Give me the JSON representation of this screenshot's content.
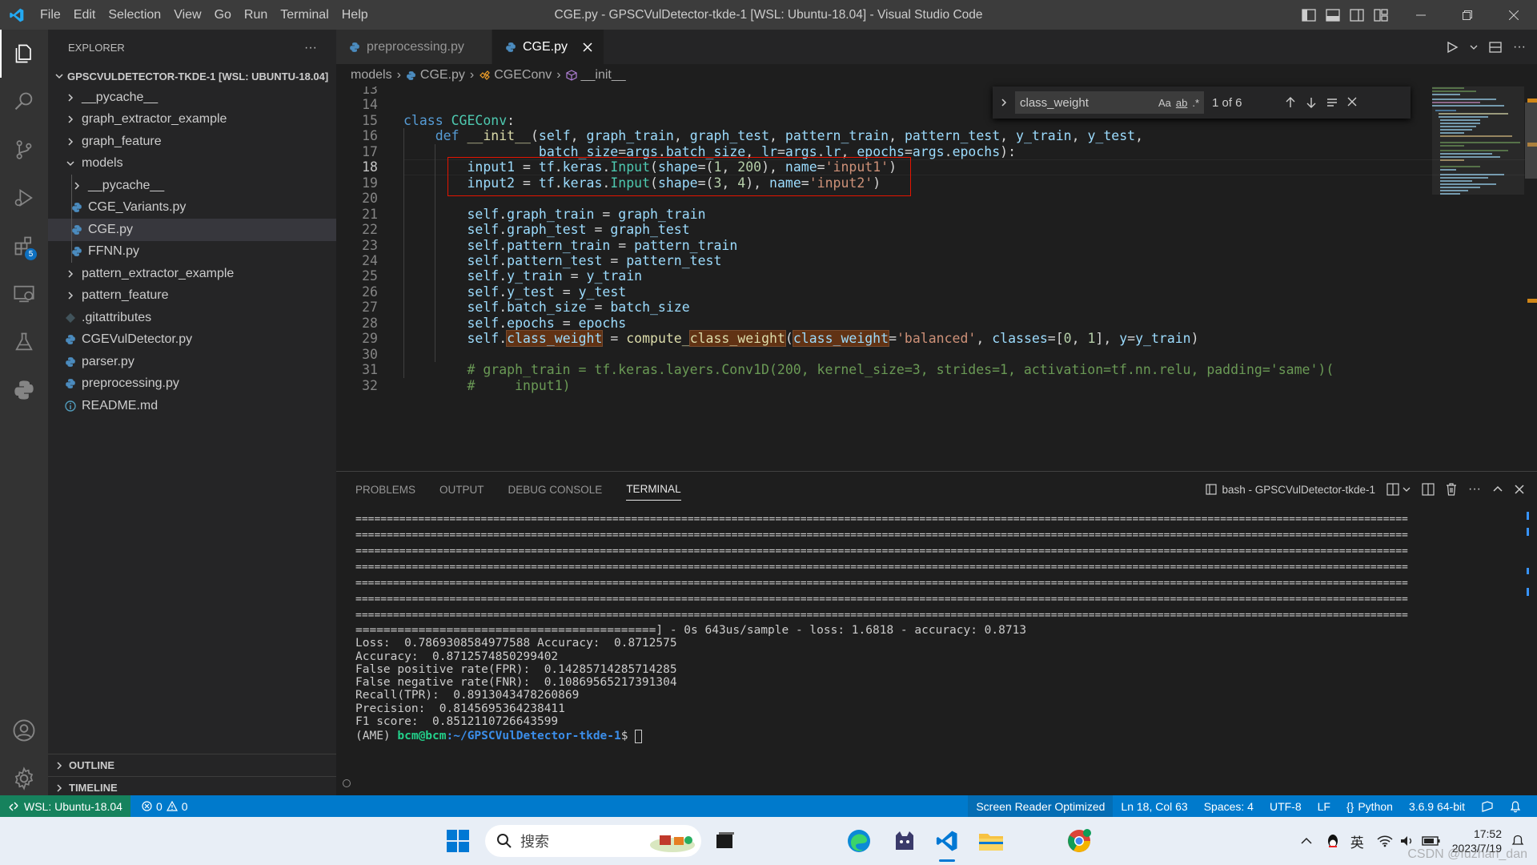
{
  "window": {
    "title": "CGE.py - GPSCVulDetector-tkde-1 [WSL: Ubuntu-18.04] - Visual Studio Code",
    "menu": [
      "File",
      "Edit",
      "Selection",
      "View",
      "Go",
      "Run",
      "Terminal",
      "Help"
    ]
  },
  "activity_bar": {
    "extensions_badge": "5",
    "icons": [
      "explorer-icon",
      "search-icon",
      "source-control-icon",
      "run-debug-icon",
      "extensions-icon",
      "remote-explorer-icon",
      "testing-icon",
      "python-icon",
      "accounts-icon",
      "settings-icon"
    ]
  },
  "explorer": {
    "header": "EXPLORER",
    "more": "···",
    "root": "GPSCVULDETECTOR-TKDE-1 [WSL: UBUNTU-18.04]",
    "items": [
      {
        "label": "__pycache__",
        "type": "folder",
        "depth": 0,
        "open": false
      },
      {
        "label": "graph_extractor_example",
        "type": "folder",
        "depth": 0,
        "open": false
      },
      {
        "label": "graph_feature",
        "type": "folder",
        "depth": 0,
        "open": false
      },
      {
        "label": "models",
        "type": "folder",
        "depth": 0,
        "open": true
      },
      {
        "label": "__pycache__",
        "type": "folder",
        "depth": 1,
        "open": false
      },
      {
        "label": "CGE_Variants.py",
        "type": "py",
        "depth": 1
      },
      {
        "label": "CGE.py",
        "type": "py",
        "depth": 1,
        "selected": true
      },
      {
        "label": "FFNN.py",
        "type": "py",
        "depth": 1
      },
      {
        "label": "pattern_extractor_example",
        "type": "folder",
        "depth": 0,
        "open": false
      },
      {
        "label": "pattern_feature",
        "type": "folder",
        "depth": 0,
        "open": false
      },
      {
        "label": ".gitattributes",
        "type": "git",
        "depth": 0
      },
      {
        "label": "CGEVulDetector.py",
        "type": "py",
        "depth": 0
      },
      {
        "label": "parser.py",
        "type": "py",
        "depth": 0
      },
      {
        "label": "preprocessing.py",
        "type": "py",
        "depth": 0
      },
      {
        "label": "README.md",
        "type": "md",
        "depth": 0
      }
    ],
    "outline": "OUTLINE",
    "timeline": "TIMELINE"
  },
  "tabs": [
    {
      "label": "preprocessing.py",
      "active": false
    },
    {
      "label": "CGE.py",
      "active": true
    }
  ],
  "breadcrumb": [
    "models",
    "CGE.py",
    "CGEConv",
    "__init__"
  ],
  "find_widget": {
    "query": "class_weight",
    "case_opt": "Aa",
    "word_opt": "ab",
    "regex_opt": ".*",
    "count": "1 of 6"
  },
  "editor": {
    "current_line": "18",
    "lines": [
      {
        "n": "13",
        "t": []
      },
      {
        "n": "14",
        "t": []
      },
      {
        "n": "15",
        "t": [
          [
            "kw",
            "class "
          ],
          [
            "cls",
            "CGEConv"
          ],
          [
            "pl",
            ":"
          ]
        ]
      },
      {
        "n": "16",
        "t": [
          [
            "pl",
            "    "
          ],
          [
            "kw",
            "def "
          ],
          [
            "fn",
            "__init__"
          ],
          [
            "pl",
            "("
          ],
          [
            "var",
            "self"
          ],
          [
            "pl",
            ", "
          ],
          [
            "var",
            "graph_train"
          ],
          [
            "pl",
            ", "
          ],
          [
            "var",
            "graph_test"
          ],
          [
            "pl",
            ", "
          ],
          [
            "var",
            "pattern_train"
          ],
          [
            "pl",
            ", "
          ],
          [
            "var",
            "pattern_test"
          ],
          [
            "pl",
            ", "
          ],
          [
            "var",
            "y_train"
          ],
          [
            "pl",
            ", "
          ],
          [
            "var",
            "y_test"
          ],
          [
            "pl",
            ","
          ]
        ]
      },
      {
        "n": "17",
        "t": [
          [
            "pl",
            "                 "
          ],
          [
            "var",
            "batch_size"
          ],
          [
            "pl",
            "="
          ],
          [
            "var",
            "args"
          ],
          [
            "pl",
            "."
          ],
          [
            "var",
            "batch_size"
          ],
          [
            "pl",
            ", "
          ],
          [
            "var",
            "lr"
          ],
          [
            "pl",
            "="
          ],
          [
            "var",
            "args"
          ],
          [
            "pl",
            "."
          ],
          [
            "var",
            "lr"
          ],
          [
            "pl",
            ", "
          ],
          [
            "var",
            "epochs"
          ],
          [
            "pl",
            "="
          ],
          [
            "var",
            "args"
          ],
          [
            "pl",
            "."
          ],
          [
            "var",
            "epochs"
          ],
          [
            "pl",
            "):"
          ]
        ]
      },
      {
        "n": "18",
        "t": [
          [
            "pl",
            "        "
          ],
          [
            "var",
            "input1"
          ],
          [
            "pl",
            " = "
          ],
          [
            "var",
            "tf"
          ],
          [
            "pl",
            "."
          ],
          [
            "var",
            "keras"
          ],
          [
            "pl",
            "."
          ],
          [
            "cls",
            "Input"
          ],
          [
            "pl",
            "("
          ],
          [
            "var",
            "shape"
          ],
          [
            "pl",
            "=("
          ],
          [
            "num",
            "1"
          ],
          [
            "pl",
            ", "
          ],
          [
            "num",
            "200"
          ],
          [
            "pl",
            "), "
          ],
          [
            "var",
            "name"
          ],
          [
            "pl",
            "="
          ],
          [
            "str",
            "'input1'"
          ],
          [
            "pl",
            ")"
          ]
        ]
      },
      {
        "n": "19",
        "t": [
          [
            "pl",
            "        "
          ],
          [
            "var",
            "input2"
          ],
          [
            "pl",
            " = "
          ],
          [
            "var",
            "tf"
          ],
          [
            "pl",
            "."
          ],
          [
            "var",
            "keras"
          ],
          [
            "pl",
            "."
          ],
          [
            "cls",
            "Input"
          ],
          [
            "pl",
            "("
          ],
          [
            "var",
            "shape"
          ],
          [
            "pl",
            "=("
          ],
          [
            "num",
            "3"
          ],
          [
            "pl",
            ", "
          ],
          [
            "num",
            "4"
          ],
          [
            "pl",
            "), "
          ],
          [
            "var",
            "name"
          ],
          [
            "pl",
            "="
          ],
          [
            "str",
            "'input2'"
          ],
          [
            "pl",
            ")"
          ]
        ]
      },
      {
        "n": "20",
        "t": []
      },
      {
        "n": "21",
        "t": [
          [
            "pl",
            "        "
          ],
          [
            "var",
            "self"
          ],
          [
            "pl",
            "."
          ],
          [
            "var",
            "graph_train"
          ],
          [
            "pl",
            " = "
          ],
          [
            "var",
            "graph_train"
          ]
        ]
      },
      {
        "n": "22",
        "t": [
          [
            "pl",
            "        "
          ],
          [
            "var",
            "self"
          ],
          [
            "pl",
            "."
          ],
          [
            "var",
            "graph_test"
          ],
          [
            "pl",
            " = "
          ],
          [
            "var",
            "graph_test"
          ]
        ]
      },
      {
        "n": "23",
        "t": [
          [
            "pl",
            "        "
          ],
          [
            "var",
            "self"
          ],
          [
            "pl",
            "."
          ],
          [
            "var",
            "pattern_train"
          ],
          [
            "pl",
            " = "
          ],
          [
            "var",
            "pattern_train"
          ]
        ]
      },
      {
        "n": "24",
        "t": [
          [
            "pl",
            "        "
          ],
          [
            "var",
            "self"
          ],
          [
            "pl",
            "."
          ],
          [
            "var",
            "pattern_test"
          ],
          [
            "pl",
            " = "
          ],
          [
            "var",
            "pattern_test"
          ]
        ]
      },
      {
        "n": "25",
        "t": [
          [
            "pl",
            "        "
          ],
          [
            "var",
            "self"
          ],
          [
            "pl",
            "."
          ],
          [
            "var",
            "y_train"
          ],
          [
            "pl",
            " = "
          ],
          [
            "var",
            "y_train"
          ]
        ]
      },
      {
        "n": "26",
        "t": [
          [
            "pl",
            "        "
          ],
          [
            "var",
            "self"
          ],
          [
            "pl",
            "."
          ],
          [
            "var",
            "y_test"
          ],
          [
            "pl",
            " = "
          ],
          [
            "var",
            "y_test"
          ]
        ]
      },
      {
        "n": "27",
        "t": [
          [
            "pl",
            "        "
          ],
          [
            "var",
            "self"
          ],
          [
            "pl",
            "."
          ],
          [
            "var",
            "batch_size"
          ],
          [
            "pl",
            " = "
          ],
          [
            "var",
            "batch_size"
          ]
        ]
      },
      {
        "n": "28",
        "t": [
          [
            "pl",
            "        "
          ],
          [
            "var",
            "self"
          ],
          [
            "pl",
            "."
          ],
          [
            "var",
            "epochs"
          ],
          [
            "pl",
            " = "
          ],
          [
            "var",
            "epochs"
          ]
        ]
      },
      {
        "n": "29",
        "t": [
          [
            "pl",
            "        "
          ],
          [
            "var",
            "self"
          ],
          [
            "pl",
            "."
          ],
          [
            "var hl",
            "class_weight"
          ],
          [
            "pl",
            " = "
          ],
          [
            "fn",
            "compute_"
          ],
          [
            "fn hl",
            "class_weight"
          ],
          [
            "pl",
            "("
          ],
          [
            "var hl",
            "class_weight"
          ],
          [
            "pl",
            "="
          ],
          [
            "str",
            "'balanced'"
          ],
          [
            "pl",
            ", "
          ],
          [
            "var",
            "classes"
          ],
          [
            "pl",
            "=["
          ],
          [
            "num",
            "0"
          ],
          [
            "pl",
            ", "
          ],
          [
            "num",
            "1"
          ],
          [
            "pl",
            "], "
          ],
          [
            "var",
            "y"
          ],
          [
            "pl",
            "="
          ],
          [
            "var",
            "y_train"
          ],
          [
            "pl",
            ")"
          ]
        ]
      },
      {
        "n": "30",
        "t": []
      },
      {
        "n": "31",
        "t": [
          [
            "cm",
            "        # graph_train = tf.keras.layers.Conv1D(200, kernel_size=3, strides=1, activation=tf.nn.relu, padding='same')("
          ]
        ]
      },
      {
        "n": "32",
        "t": [
          [
            "cm",
            "        #     input1)"
          ]
        ]
      }
    ]
  },
  "panel": {
    "tabs": [
      "PROBLEMS",
      "OUTPUT",
      "DEBUG CONSOLE",
      "TERMINAL"
    ],
    "active_tab": "TERMINAL",
    "terminal_name": "bash - GPSCVulDetector-tkde-1",
    "terminal_lines": [
      "========================================================================================================================================================================",
      "========================================================================================================================================================================",
      "========================================================================================================================================================================",
      "========================================================================================================================================================================",
      "========================================================================================================================================================================",
      "========================================================================================================================================================================",
      "========================================================================================================================================================================",
      "===========================================] - 0s 643us/sample - loss: 1.6818 - accuracy: 0.8713",
      "Loss:  0.7869308584977588 Accuracy:  0.8712575",
      "Accuracy:  0.8712574850299402",
      "False positive rate(FPR):  0.14285714285714285",
      "False negative rate(FNR):  0.10869565217391304",
      "Recall(TPR):  0.8913043478260869",
      "Precision:  0.8145695364238411",
      "F1 score:  0.8512110726643599"
    ],
    "prompt_prefix": "(AME) ",
    "prompt_user": "bcm@bcm",
    "prompt_path": ":~/GPSCVulDetector-tkde-1",
    "prompt_suffix": "$ "
  },
  "statusbar": {
    "remote": "WSL: Ubuntu-18.04",
    "errors": "0",
    "warnings": "0",
    "screen_reader": "Screen Reader Optimized",
    "position": "Ln 18, Col 63",
    "spaces": "Spaces: 4",
    "encoding": "UTF-8",
    "eol": "LF",
    "language": "Python",
    "interpreter": "3.6.9 64-bit"
  },
  "taskbar": {
    "search_placeholder": "搜索",
    "ime": "英",
    "time": "17:52",
    "date": "2023/7/19",
    "watermark": "CSDN @fuzhan_dan"
  },
  "colors": {
    "accent": "#007acc",
    "remote": "#16825d",
    "find_highlight": "#613214",
    "annotation_box": "#e51400"
  }
}
